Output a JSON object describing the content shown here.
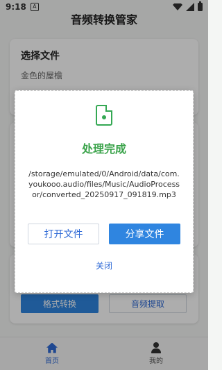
{
  "status_bar": {
    "time": "9:18",
    "notification_label": "A",
    "icons": [
      "wifi-icon",
      "signal-icon",
      "battery-icon"
    ]
  },
  "app": {
    "title": "音频转换管家"
  },
  "main": {
    "select_file": {
      "title": "选择文件",
      "file_name": "金色的屋檐"
    },
    "actions": {
      "convert_label": "格式转换",
      "extract_label": "音频提取"
    }
  },
  "dialog": {
    "icon": "audio-file-icon",
    "title": "处理完成",
    "path": "/storage/emulated/0/Android/data/com.youkooo.audio/files/Music/AudioProcessor/converted_20250917_091819.mp3",
    "open_label": "打开文件",
    "share_label": "分享文件",
    "close_label": "关闭"
  },
  "bottom_nav": {
    "items": [
      {
        "label": "首页",
        "icon": "home-icon",
        "active": true
      },
      {
        "label": "我的",
        "icon": "person-icon",
        "active": false
      }
    ]
  },
  "colors": {
    "accent": "#2f85e0",
    "success": "#3aa34a"
  }
}
